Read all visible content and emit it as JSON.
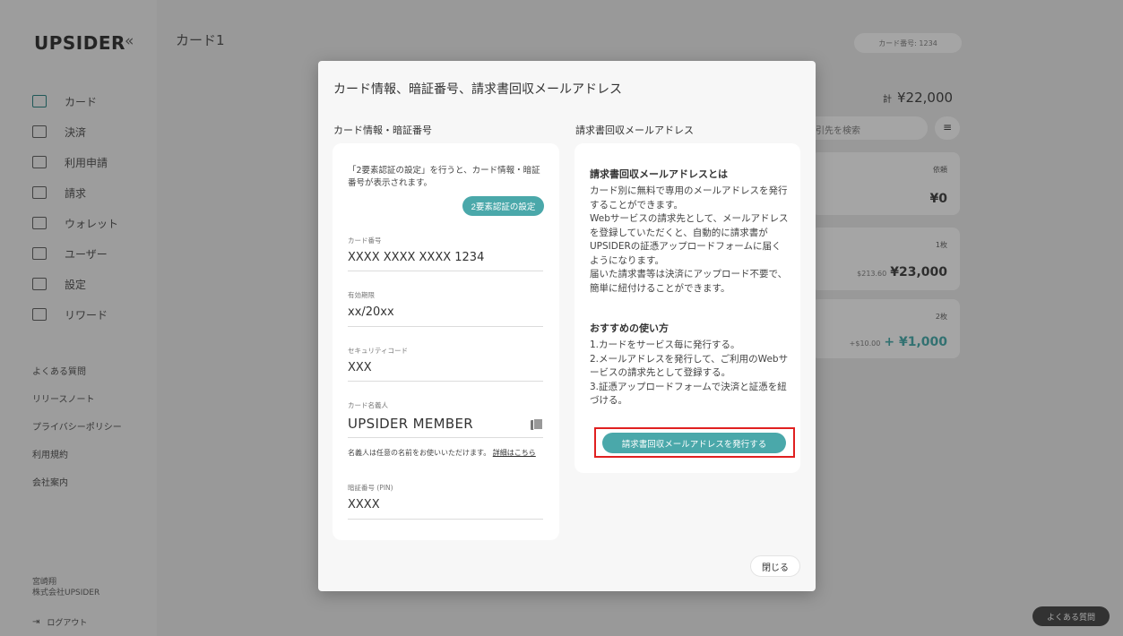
{
  "sidebar": {
    "logo": "UPSIDER",
    "collapse": "«",
    "items": [
      {
        "label": "カード"
      },
      {
        "label": "決済"
      },
      {
        "label": "利用申請"
      },
      {
        "label": "請求"
      },
      {
        "label": "ウォレット"
      },
      {
        "label": "ユーザー"
      },
      {
        "label": "設定"
      },
      {
        "label": "リワード"
      }
    ],
    "links": [
      "よくある質問",
      "リリースノート",
      "プライバシーポリシー",
      "利用規約",
      "会社案内"
    ],
    "user_name": "宮崎翔",
    "user_company": "株式会社UPSIDER",
    "logout": "ログアウト"
  },
  "background": {
    "page_title": "カード1",
    "top_pill": "カード番号: 1234",
    "total_label": "計",
    "total_value": "¥22,000",
    "search_placeholder": "引先を検索",
    "filter_icon": "≡",
    "cards": [
      {
        "badge": "依頼",
        "amount": "¥0",
        "sub": ""
      },
      {
        "badge": "1枚",
        "amount": "¥23,000",
        "sub": "$213.60"
      },
      {
        "badge": "2枚",
        "amount": "+ ¥1,000",
        "sub": "+$10.00"
      }
    ],
    "help_button": "よくある質問"
  },
  "modal": {
    "title": "カード情報、暗証番号、請求書回収メールアドレス",
    "left_heading": "カード情報・暗証番号",
    "right_heading": "請求書回収メールアドレス",
    "twofa_note": "「2要素認証の設定」を行うと、カード情報・暗証番号が表示されます。",
    "twofa_button": "2要素認証の設定",
    "fields": [
      {
        "label": "カード番号",
        "value": "XXXX XXXX XXXX 1234"
      },
      {
        "label": "有効期限",
        "value": "xx/20xx"
      },
      {
        "label": "セキュリティコード",
        "value": "XXX"
      },
      {
        "label": "カード名義人",
        "value": "UPSIDER MEMBER"
      },
      {
        "label": "暗証番号 (PIN)",
        "value": "XXXX"
      }
    ],
    "name_note": "名義人は任意の名前をお使いいただけます。",
    "name_note_link": "詳細はこちら",
    "about_heading": "請求書回収メールアドレスとは",
    "about_body": "カード別に無料で専用のメールアドレスを発行することができます。\nWebサービスの請求先として、メールアドレスを登録していただくと、自動的に請求書がUPSIDERの証憑アップロードフォームに届くようになります。\n届いた請求書等は決済にアップロード不要で、簡単に紐付けることができます。",
    "howto_heading": "おすすめの使い方",
    "howto_body": "1.カードをサービス毎に発行する。\n2.メールアドレスを発行して、ご利用のWebサービスの請求先として登録する。\n3.証憑アップロードフォームで決済と証憑を紐づける。",
    "issue_button": "請求書回収メールアドレスを発行する",
    "close_button": "閉じる"
  },
  "colors": {
    "accent": "#4aa8aa",
    "highlight": "#e02020"
  }
}
